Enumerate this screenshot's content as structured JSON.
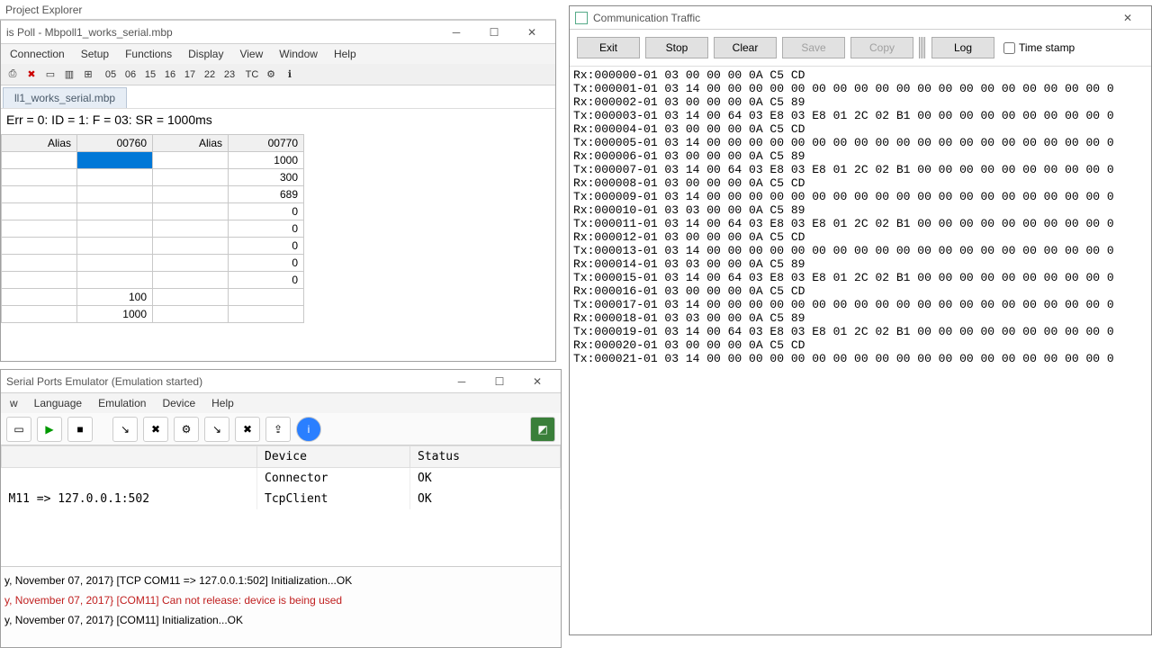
{
  "explorer": {
    "title": "Project Explorer"
  },
  "poll": {
    "title": "is Poll - Mbpoll1_works_serial.mbp",
    "menu": [
      "Connection",
      "Setup",
      "Functions",
      "Display",
      "View",
      "Window",
      "Help"
    ],
    "tb_nums": [
      "05",
      "06",
      "15",
      "16",
      "17",
      "22",
      "23"
    ],
    "tab": "ll1_works_serial.mbp",
    "status": "Err = 0: ID = 1: F = 03: SR = 1000ms",
    "headers": {
      "alias": "Alias",
      "c1": "00760",
      "c2": "00770"
    },
    "rows": [
      {
        "a1": "",
        "v1": "",
        "a2": "",
        "v2": "1000",
        "sel": true
      },
      {
        "a1": "",
        "v1": "",
        "a2": "",
        "v2": "300"
      },
      {
        "a1": "",
        "v1": "",
        "a2": "",
        "v2": "689"
      },
      {
        "a1": "",
        "v1": "",
        "a2": "",
        "v2": "0"
      },
      {
        "a1": "",
        "v1": "",
        "a2": "",
        "v2": "0"
      },
      {
        "a1": "",
        "v1": "",
        "a2": "",
        "v2": "0"
      },
      {
        "a1": "",
        "v1": "",
        "a2": "",
        "v2": "0"
      },
      {
        "a1": "",
        "v1": "",
        "a2": "",
        "v2": "0"
      },
      {
        "a1": "",
        "v1": "100",
        "a2": "",
        "v2": ""
      },
      {
        "a1": "",
        "v1": "1000",
        "a2": "",
        "v2": ""
      }
    ]
  },
  "emu": {
    "title": "Serial Ports Emulator (Emulation started)",
    "menu": [
      "w",
      "Language",
      "Emulation",
      "Device",
      "Help"
    ],
    "cols": {
      "c0": "",
      "device": "Device",
      "status": "Status"
    },
    "rows": [
      {
        "c0": "",
        "device": "Connector",
        "status": "OK"
      },
      {
        "c0": "M11 => 127.0.0.1:502",
        "device": "TcpClient",
        "status": "OK"
      }
    ],
    "log": [
      {
        "t": "y, November 07, 2017} [TCP COM11 => 127.0.0.1:502] Initialization...OK",
        "err": false
      },
      {
        "t": "y, November 07, 2017} [COM11] Can not release: device is being used",
        "err": true
      },
      {
        "t": "y, November 07, 2017} [COM11] Initialization...OK",
        "err": false
      }
    ]
  },
  "comm": {
    "title": "Communication Traffic",
    "buttons": {
      "exit": "Exit",
      "stop": "Stop",
      "clear": "Clear",
      "save": "Save",
      "copy": "Copy",
      "log": "Log",
      "ts": "Time stamp"
    },
    "lines": [
      "Rx:000000-01 03 00 00 00 0A C5 CD",
      "Tx:000001-01 03 14 00 00 00 00 00 00 00 00 00 00 00 00 00 00 00 00 00 00 00 0",
      "Rx:000002-01 03 00 00 00 0A C5 89",
      "Tx:000003-01 03 14 00 64 03 E8 03 E8 01 2C 02 B1 00 00 00 00 00 00 00 00 00 0",
      "Rx:000004-01 03 00 00 00 0A C5 CD",
      "Tx:000005-01 03 14 00 00 00 00 00 00 00 00 00 00 00 00 00 00 00 00 00 00 00 0",
      "Rx:000006-01 03 00 00 00 0A C5 89",
      "Tx:000007-01 03 14 00 64 03 E8 03 E8 01 2C 02 B1 00 00 00 00 00 00 00 00 00 0",
      "Rx:000008-01 03 00 00 00 0A C5 CD",
      "Tx:000009-01 03 14 00 00 00 00 00 00 00 00 00 00 00 00 00 00 00 00 00 00 00 0",
      "Rx:000010-01 03 03 00 00 0A C5 89",
      "Tx:000011-01 03 14 00 64 03 E8 03 E8 01 2C 02 B1 00 00 00 00 00 00 00 00 00 0",
      "Rx:000012-01 03 00 00 00 0A C5 CD",
      "Tx:000013-01 03 14 00 00 00 00 00 00 00 00 00 00 00 00 00 00 00 00 00 00 00 0",
      "Rx:000014-01 03 03 00 00 0A C5 89",
      "Tx:000015-01 03 14 00 64 03 E8 03 E8 01 2C 02 B1 00 00 00 00 00 00 00 00 00 0",
      "Rx:000016-01 03 00 00 00 0A C5 CD",
      "Tx:000017-01 03 14 00 00 00 00 00 00 00 00 00 00 00 00 00 00 00 00 00 00 00 0",
      "Rx:000018-01 03 03 00 00 0A C5 89",
      "Tx:000019-01 03 14 00 64 03 E8 03 E8 01 2C 02 B1 00 00 00 00 00 00 00 00 00 0",
      "Rx:000020-01 03 00 00 00 0A C5 CD",
      "Tx:000021-01 03 14 00 00 00 00 00 00 00 00 00 00 00 00 00 00 00 00 00 00 00 0"
    ]
  }
}
